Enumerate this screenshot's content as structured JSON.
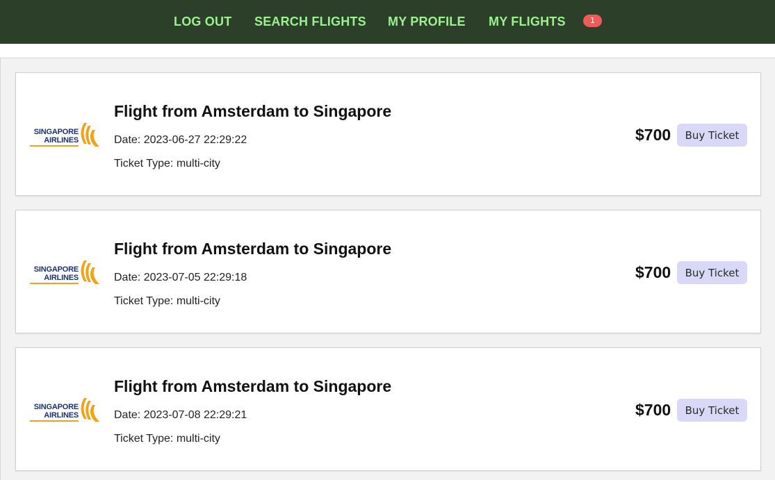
{
  "nav": {
    "links": [
      "LOG OUT",
      "SEARCH FLIGHTS",
      "MY PROFILE",
      "MY FLIGHTS"
    ],
    "badge_count": "1"
  },
  "logo": {
    "line1": "SINGAPORE",
    "line2": "AIRLINES"
  },
  "colors": {
    "nav_bg": "#2b3f29",
    "nav_link": "#9cf28f",
    "badge": "#f05a5a",
    "button_bg": "#d9d9f7",
    "logo_blue": "#1a2f6b",
    "logo_gold": "#f0a21a"
  },
  "flights": [
    {
      "title": "Flight from Amsterdam to Singapore",
      "date": "Date: 2023-06-27 22:29:22",
      "ticket_type": "Ticket Type: multi-city",
      "price": "$700",
      "button_label": "Buy Ticket"
    },
    {
      "title": "Flight from Amsterdam to Singapore",
      "date": "Date: 2023-07-05 22:29:18",
      "ticket_type": "Ticket Type: multi-city",
      "price": "$700",
      "button_label": "Buy Ticket"
    },
    {
      "title": "Flight from Amsterdam to Singapore",
      "date": "Date: 2023-07-08 22:29:21",
      "ticket_type": "Ticket Type: multi-city",
      "price": "$700",
      "button_label": "Buy Ticket"
    }
  ]
}
